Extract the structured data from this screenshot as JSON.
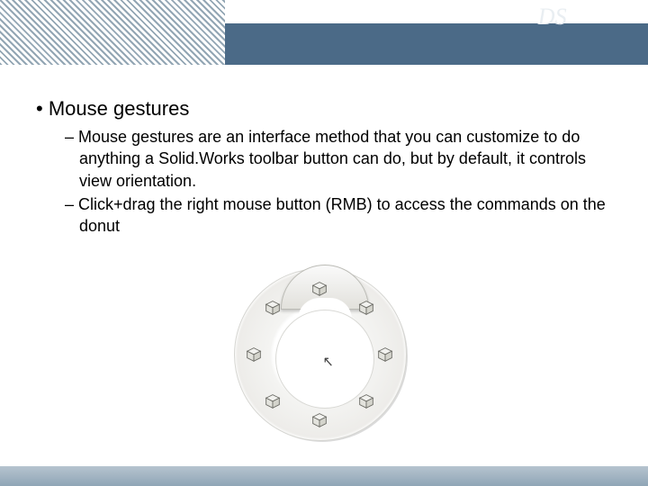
{
  "brand": {
    "ds_mark": "DS",
    "name_a": "Solid",
    "name_b": "Works"
  },
  "slide": {
    "heading": "Mouse gestures",
    "bullets": [
      "Mouse gestures are an interface method that you can customize to do anything a Solid.Works toolbar button can do, but by default, it controls view orientation.",
      "Click+drag the right mouse button (RMB) to access the commands on the donut"
    ]
  },
  "donut": {
    "cursor_glyph": "↖",
    "segments": [
      {
        "name": "view-top-icon",
        "angle": -90
      },
      {
        "name": "view-trimetric-icon",
        "angle": -45
      },
      {
        "name": "view-right-icon",
        "angle": 0
      },
      {
        "name": "view-dimetric-icon",
        "angle": 45
      },
      {
        "name": "view-bottom-icon",
        "angle": 90
      },
      {
        "name": "view-isometric-icon",
        "angle": 135
      },
      {
        "name": "view-left-icon",
        "angle": 180
      },
      {
        "name": "view-front-icon",
        "angle": 225
      }
    ]
  }
}
